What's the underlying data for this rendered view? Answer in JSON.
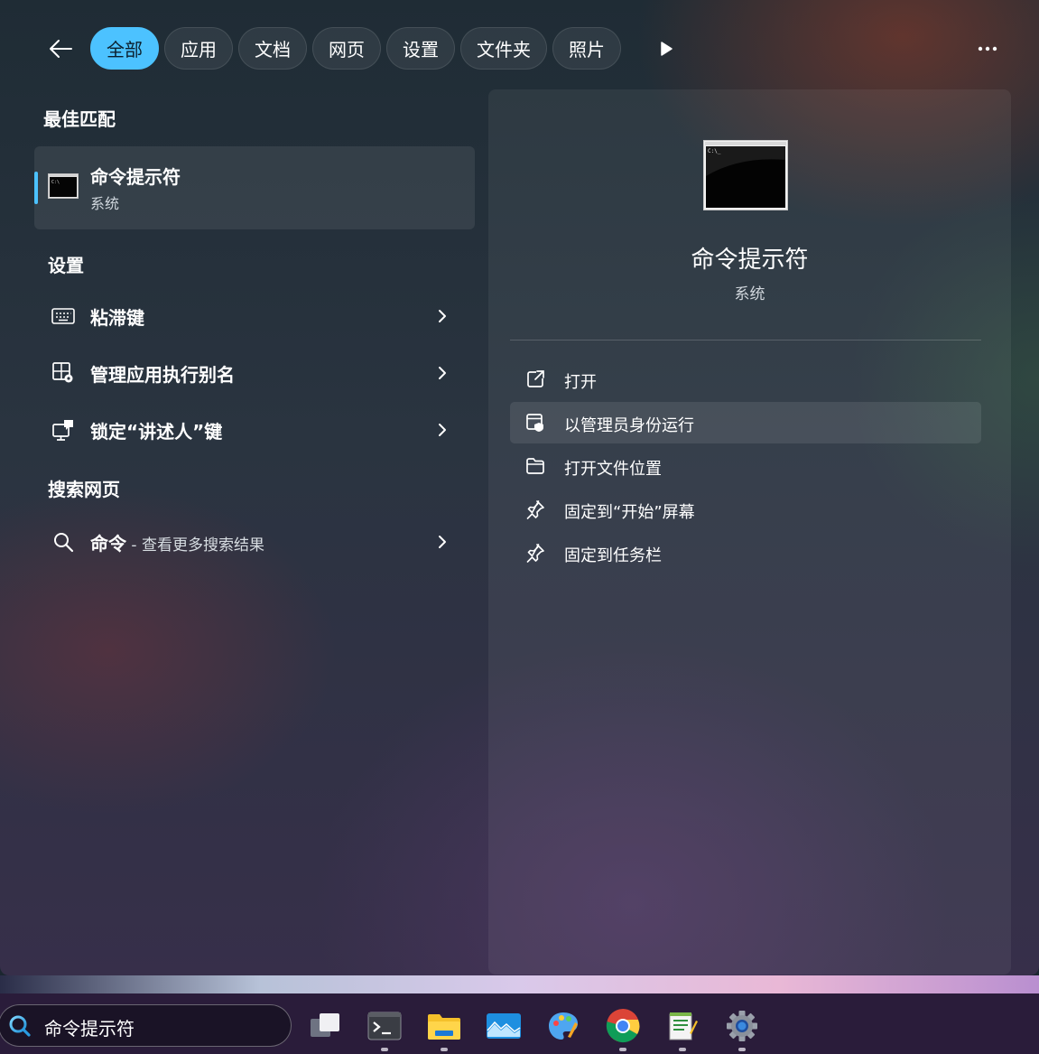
{
  "filters": {
    "items": [
      {
        "label": "全部",
        "active": true
      },
      {
        "label": "应用",
        "active": false
      },
      {
        "label": "文档",
        "active": false
      },
      {
        "label": "网页",
        "active": false
      },
      {
        "label": "设置",
        "active": false
      },
      {
        "label": "文件夹",
        "active": false
      },
      {
        "label": "照片",
        "active": false
      }
    ]
  },
  "best_match": {
    "title": "最佳匹配",
    "name": "命令提示符",
    "type": "系统"
  },
  "settings": {
    "title": "设置",
    "items": [
      {
        "label": "粘滞键",
        "icon": "keyboard-icon"
      },
      {
        "label": "管理应用执行别名",
        "icon": "app-alias-icon"
      },
      {
        "label": "锁定“讲述人”键",
        "icon": "narrator-lock-icon"
      }
    ]
  },
  "web": {
    "title": "搜索网页",
    "query": "命令",
    "suffix": " - 查看更多搜索结果"
  },
  "preview": {
    "name": "命令提示符",
    "type": "系统",
    "actions": [
      {
        "label": "打开",
        "icon": "open-external-icon"
      },
      {
        "label": "以管理员身份运行",
        "icon": "shield-run-icon"
      },
      {
        "label": "打开文件位置",
        "icon": "folder-icon"
      },
      {
        "label": "固定到“开始”屏幕",
        "icon": "pin-icon"
      },
      {
        "label": "固定到任务栏",
        "icon": "pin-icon"
      }
    ]
  },
  "taskbar": {
    "search_text": "命令提示符",
    "apps": [
      "task-view",
      "terminal",
      "file-explorer",
      "photos",
      "paint",
      "chrome",
      "notepad",
      "settings"
    ]
  },
  "colors": {
    "accent": "#4cc2ff"
  }
}
